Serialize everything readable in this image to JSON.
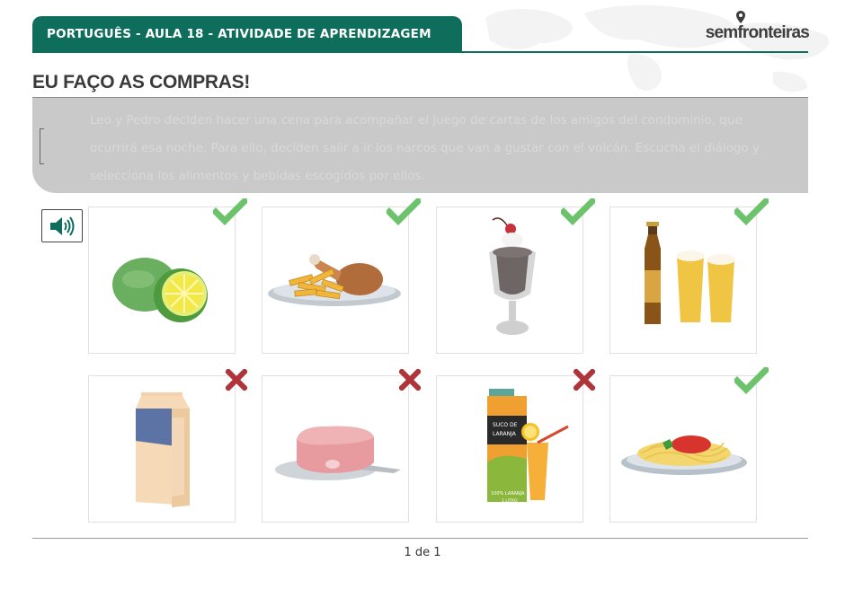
{
  "header": {
    "course_title": "PORTUGUÊS - AULA 18 - ATIVIDADE DE APRENDIZAGEM",
    "logo": {
      "part1": "sem",
      "part2": "fronteiras"
    }
  },
  "page_title": "EU FAÇO AS COMPRAS!",
  "instruction": {
    "text": "Leo y Pedro deciden hacer una cena para acompañar el juego de cartas de los amigos del condominio, que ocurrirá esa noche. Para ello, deciden salir a ir los narcos que van a gustar con el volcán. Escucha el diálogo y selecciona los alimentos y bebidas escogidos por ellos."
  },
  "colors": {
    "brand": "#0f6e5b",
    "correct": "#6cc36c",
    "wrong": "#b0353a"
  },
  "items": [
    {
      "name": "lime",
      "status": "correct"
    },
    {
      "name": "chicken-and-fries",
      "status": "correct"
    },
    {
      "name": "ice-cream-sundae",
      "status": "correct"
    },
    {
      "name": "beer",
      "status": "correct"
    },
    {
      "name": "milk-carton",
      "status": "wrong"
    },
    {
      "name": "ham",
      "status": "wrong"
    },
    {
      "name": "orange-juice",
      "status": "wrong",
      "carton_text": "SUCO DE LARANJA",
      "label_text": "100% LARANJA",
      "volume_text": "1 LITRO"
    },
    {
      "name": "spaghetti",
      "status": "correct"
    }
  ],
  "pagination": {
    "text": "1 de 1"
  }
}
